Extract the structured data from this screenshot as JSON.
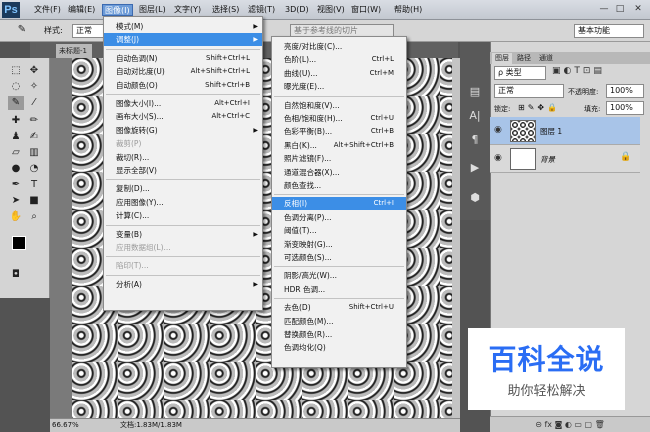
{
  "app": {
    "logo": "Ps",
    "menus": [
      "文件(F)",
      "编辑(E)",
      "图像(I)",
      "图层(L)",
      "文字(Y)",
      "选择(S)",
      "滤镜(T)",
      "3D(D)",
      "视图(V)",
      "窗口(W)",
      "帮助(H)"
    ],
    "window_controls": [
      "—",
      "□",
      "✕"
    ]
  },
  "options": {
    "style_label": "样式:",
    "style_value": "正常",
    "refine_button": "基于参考线的切片",
    "workspace": "基本功能"
  },
  "document": {
    "tab": "未标题-1 @",
    "zoom": "66.67%",
    "status": "文档:1.83M/1.83M"
  },
  "image_menu": {
    "items": [
      {
        "label": "模式(M)",
        "shortcut": "",
        "submenu": true,
        "disabled": false
      },
      {
        "label": "调整(J)",
        "shortcut": "",
        "submenu": true,
        "disabled": false,
        "highlight": true
      },
      {
        "label": "自动色调(N)",
        "shortcut": "Shift+Ctrl+L"
      },
      {
        "label": "自动对比度(U)",
        "shortcut": "Alt+Shift+Ctrl+L"
      },
      {
        "label": "自动颜色(O)",
        "shortcut": "Shift+Ctrl+B"
      },
      {
        "label": "图像大小(I)...",
        "shortcut": "Alt+Ctrl+I"
      },
      {
        "label": "画布大小(S)...",
        "shortcut": "Alt+Ctrl+C"
      },
      {
        "label": "图像旋转(G)",
        "shortcut": "",
        "submenu": true
      },
      {
        "label": "裁剪(P)",
        "shortcut": "",
        "disabled": true
      },
      {
        "label": "裁切(R)...",
        "shortcut": ""
      },
      {
        "label": "显示全部(V)",
        "shortcut": ""
      },
      {
        "label": "复制(D)...",
        "shortcut": ""
      },
      {
        "label": "应用图像(Y)...",
        "shortcut": ""
      },
      {
        "label": "计算(C)...",
        "shortcut": ""
      },
      {
        "label": "变量(B)",
        "shortcut": "",
        "submenu": true
      },
      {
        "label": "应用数据组(L)...",
        "shortcut": "",
        "disabled": true
      },
      {
        "label": "陷印(T)...",
        "shortcut": "",
        "disabled": true
      },
      {
        "label": "分析(A)",
        "shortcut": "",
        "submenu": true
      }
    ]
  },
  "adjust_menu": {
    "items": [
      {
        "label": "亮度/对比度(C)...",
        "shortcut": ""
      },
      {
        "label": "色阶(L)...",
        "shortcut": "Ctrl+L"
      },
      {
        "label": "曲线(U)...",
        "shortcut": "Ctrl+M"
      },
      {
        "label": "曝光度(E)...",
        "shortcut": ""
      },
      {
        "label": "自然饱和度(V)...",
        "shortcut": ""
      },
      {
        "label": "色相/饱和度(H)...",
        "shortcut": "Ctrl+U"
      },
      {
        "label": "色彩平衡(B)...",
        "shortcut": "Ctrl+B"
      },
      {
        "label": "黑白(K)...",
        "shortcut": "Alt+Shift+Ctrl+B"
      },
      {
        "label": "照片滤镜(F)...",
        "shortcut": ""
      },
      {
        "label": "通道混合器(X)...",
        "shortcut": ""
      },
      {
        "label": "颜色查找...",
        "shortcut": ""
      },
      {
        "label": "反相(I)",
        "shortcut": "Ctrl+I",
        "highlight": true
      },
      {
        "label": "色调分离(P)...",
        "shortcut": ""
      },
      {
        "label": "阈值(T)...",
        "shortcut": ""
      },
      {
        "label": "渐变映射(G)...",
        "shortcut": ""
      },
      {
        "label": "可选颜色(S)...",
        "shortcut": ""
      },
      {
        "label": "阴影/高光(W)...",
        "shortcut": ""
      },
      {
        "label": "HDR 色调...",
        "shortcut": ""
      },
      {
        "label": "去色(D)",
        "shortcut": "Shift+Ctrl+U"
      },
      {
        "label": "匹配颜色(M)...",
        "shortcut": ""
      },
      {
        "label": "替换颜色(R)...",
        "shortcut": ""
      },
      {
        "label": "色调均化(Q)",
        "shortcut": ""
      }
    ]
  },
  "layers": {
    "tabs": [
      "图层",
      "路径",
      "通道"
    ],
    "filter": "类型",
    "blend": "正常",
    "opacity_label": "不透明度:",
    "opacity": "100%",
    "lock_label": "锁定:",
    "fill_label": "填充:",
    "fill": "100%",
    "rows": [
      {
        "name": "图层 1",
        "selected": true
      },
      {
        "name": "背景",
        "locked": true
      }
    ]
  },
  "watermark": {
    "title": "百科全说",
    "subtitle": "助你轻松解决"
  }
}
